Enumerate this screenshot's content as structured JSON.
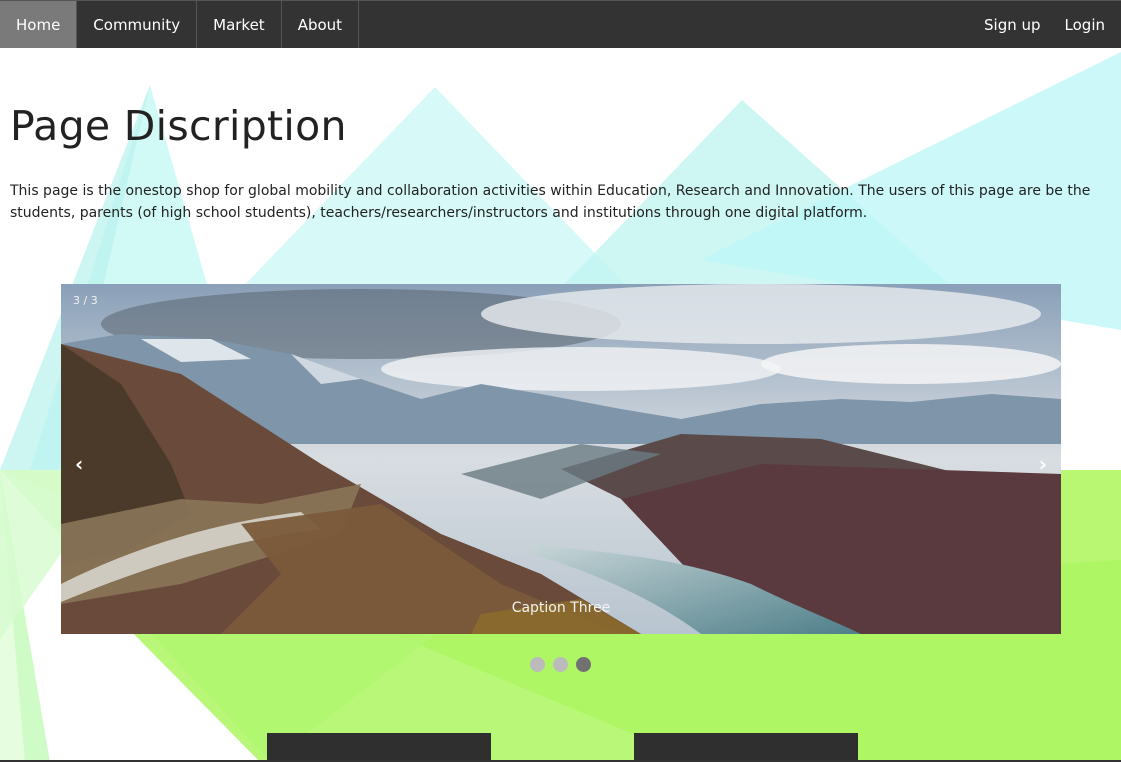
{
  "nav": {
    "left": [
      {
        "label": "Home",
        "active": true
      },
      {
        "label": "Community",
        "active": false
      },
      {
        "label": "Market",
        "active": false
      },
      {
        "label": "About",
        "active": false
      }
    ],
    "right": [
      {
        "label": "Sign up"
      },
      {
        "label": "Login"
      }
    ]
  },
  "page": {
    "title": "Page Discription",
    "description": "This page is the onestop shop for global mobility and collaboration activities within Education, Research and Innovation. The users of this page are be the students, parents (of high school students), teachers/researchers/instructors and institutions through one digital platform."
  },
  "slideshow": {
    "counter": "3 / 3",
    "caption": "Caption Three",
    "prev_symbol": "‹",
    "next_symbol": "›",
    "dots": 3,
    "active_dot": 3
  },
  "colors": {
    "nav_bg": "#333333",
    "nav_active": "#7a7a7a",
    "accent_cyan": "#bff7f2",
    "accent_green": "#a8f55a"
  }
}
